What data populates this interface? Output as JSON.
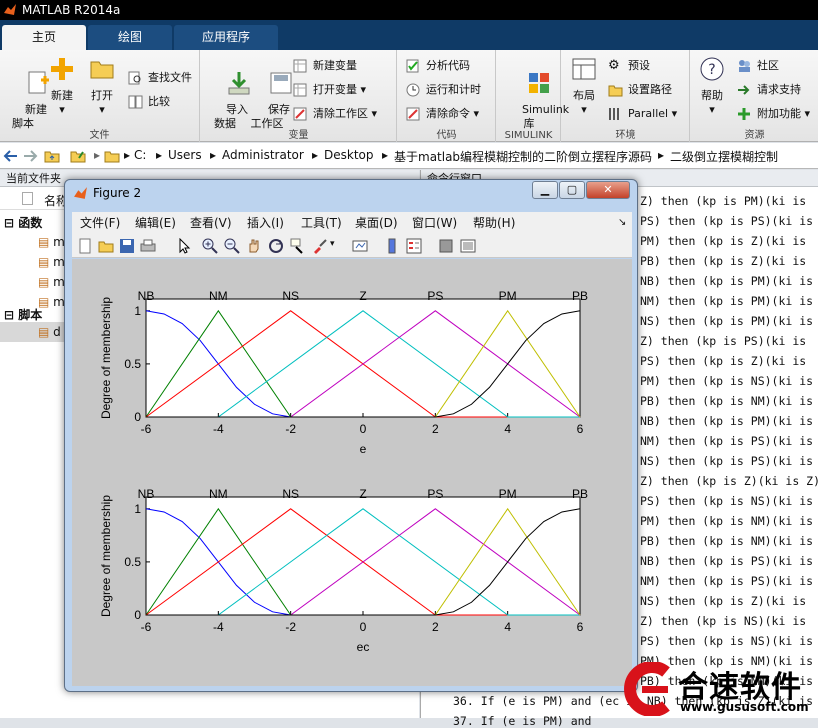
{
  "app": {
    "title": "MATLAB R2014a"
  },
  "tabs": [
    "主页",
    "绘图",
    "应用程序"
  ],
  "ribbon": {
    "file": {
      "label": "文件",
      "new_script": "新建\n脚本",
      "new": "新建",
      "open": "打开",
      "find_files": "查找文件",
      "compare": "比较"
    },
    "variable": {
      "label": "变量",
      "import_data": "导入\n数据",
      "save_workspace": "保存\n工作区",
      "new_variable": "新建变量",
      "open_variable": "打开变量",
      "clear_workspace": "清除工作区"
    },
    "code": {
      "label": "代码",
      "analyze_code": "分析代码",
      "run_and_time": "运行和计时",
      "clear_commands": "清除命令"
    },
    "simulink": {
      "label": "SIMULINK",
      "library": "Simulink\n库"
    },
    "environment": {
      "label": "环境",
      "layout": "布局",
      "preferences": "预设",
      "set_path": "设置路径",
      "parallel": "Parallel"
    },
    "resources": {
      "label": "资源",
      "help": "帮助",
      "community": "社区",
      "request_support": "请求支持",
      "add_ons": "附加功能"
    }
  },
  "address": {
    "crumbs": [
      "C:",
      "Users",
      "Administrator",
      "Desktop",
      "基于matlab编程模糊控制的二阶倒立摆程序源码",
      "二级倒立摆模糊控制"
    ]
  },
  "current_folder": {
    "title": "当前文件夹",
    "name_header": "名称",
    "groups": [
      {
        "label": "函数",
        "items": [
          "m",
          "m",
          "m",
          "m"
        ]
      },
      {
        "label": "脚本",
        "items": [
          "d"
        ]
      }
    ]
  },
  "command_window": {
    "title": "命令行窗口",
    "lines": [
      "Z) then (kp is PM)(ki is",
      "PS) then (kp is PS)(ki is",
      "PM) then (kp is Z)(ki is",
      "PB) then (kp is Z)(ki is",
      "NB) then (kp is PM)(ki is",
      "NM) then (kp is PM)(ki is",
      "NS) then (kp is PM)(ki is",
      "Z) then (kp is PS)(ki is",
      "PS) then (kp is Z)(ki is",
      "PM) then (kp is NS)(ki is",
      "PB) then (kp is NM)(ki is",
      "NB) then (kp is PM)(ki is",
      "NM) then (kp is PS)(ki is",
      "NS) then (kp is PS)(ki is",
      "Z) then (kp is Z)(ki is Z)",
      "PS) then (kp is NS)(ki is",
      "PM) then (kp is NM)(ki is",
      "PB) then (kp is NM)(ki is",
      "NB) then (kp is PS)(ki is",
      "NM) then (kp is PS)(ki is",
      "NS) then (kp is Z)(ki is",
      "Z) then (kp is NS)(ki is",
      "PS) then (kp is NS)(ki is",
      "PM) then (kp is NM)(ki is",
      "PB) then (kp is NM)(ki is",
      "36. If (e is PM) and (ec is NB) then (kp is Z)(ki is"
    ],
    "last_line_prefix": "37. If (e is PM) and"
  },
  "figure": {
    "title": "Figure 2",
    "menu": [
      "文件(F)",
      "编辑(E)",
      "查看(V)",
      "插入(I)",
      "工具(T)",
      "桌面(D)",
      "窗口(W)",
      "帮助(H)"
    ]
  },
  "chart_data": [
    {
      "type": "line",
      "xlabel": "e",
      "ylabel": "Degree of membership",
      "xlim": [
        -6,
        6
      ],
      "ylim": [
        0,
        1
      ],
      "xticks": [
        "-6",
        "-4",
        "-2",
        "0",
        "2",
        "4",
        "6"
      ],
      "yticks": [
        "0",
        "0.5",
        "1"
      ],
      "series": [
        {
          "name": "NB",
          "color": "#0000ff",
          "x": [
            -6,
            -5.5,
            -5,
            -4.5,
            -4,
            -3.5,
            -3,
            -2.5,
            -2,
            6
          ],
          "y": [
            1,
            0.97,
            0.88,
            0.72,
            0.5,
            0.28,
            0.12,
            0.03,
            0,
            0
          ]
        },
        {
          "name": "NM",
          "color": "#008000",
          "x": [
            -6,
            -4,
            -2,
            6
          ],
          "y": [
            0,
            1,
            0,
            0
          ]
        },
        {
          "name": "NS",
          "color": "#ff0000",
          "x": [
            -6,
            -2,
            2,
            6
          ],
          "y": [
            0,
            1,
            0,
            0
          ]
        },
        {
          "name": "Z",
          "color": "#00bfbf",
          "x": [
            -6,
            -4,
            0,
            4,
            6
          ],
          "y": [
            0,
            0,
            1,
            0,
            0
          ]
        },
        {
          "name": "PS",
          "color": "#bf00bf",
          "x": [
            -6,
            -2,
            2,
            6
          ],
          "y": [
            0,
            0,
            1,
            0
          ]
        },
        {
          "name": "PM",
          "color": "#bfbf00",
          "x": [
            -6,
            2,
            4,
            6
          ],
          "y": [
            0,
            0,
            1,
            0
          ]
        },
        {
          "name": "PB",
          "color": "#000000",
          "x": [
            -6,
            2,
            2.5,
            3,
            3.5,
            4,
            4.5,
            5,
            5.5,
            6
          ],
          "y": [
            0,
            0,
            0.03,
            0.12,
            0.28,
            0.5,
            0.72,
            0.88,
            0.97,
            1
          ]
        }
      ]
    },
    {
      "type": "line",
      "xlabel": "ec",
      "ylabel": "Degree of membership",
      "xlim": [
        -6,
        6
      ],
      "ylim": [
        0,
        1
      ],
      "xticks": [
        "-6",
        "-4",
        "-2",
        "0",
        "2",
        "4",
        "6"
      ],
      "yticks": [
        "0",
        "0.5",
        "1"
      ],
      "series": [
        {
          "name": "NB",
          "color": "#0000ff",
          "x": [
            -6,
            -5.5,
            -5,
            -4.5,
            -4,
            -3.5,
            -3,
            -2.5,
            -2,
            6
          ],
          "y": [
            1,
            0.97,
            0.88,
            0.72,
            0.5,
            0.28,
            0.12,
            0.03,
            0,
            0
          ]
        },
        {
          "name": "NM",
          "color": "#008000",
          "x": [
            -6,
            -4,
            -2,
            6
          ],
          "y": [
            0,
            1,
            0,
            0
          ]
        },
        {
          "name": "NS",
          "color": "#ff0000",
          "x": [
            -6,
            -2,
            2,
            6
          ],
          "y": [
            0,
            1,
            0,
            0
          ]
        },
        {
          "name": "Z",
          "color": "#00bfbf",
          "x": [
            -6,
            -4,
            0,
            4,
            6
          ],
          "y": [
            0,
            0,
            1,
            0,
            0
          ]
        },
        {
          "name": "PS",
          "color": "#bf00bf",
          "x": [
            -6,
            -2,
            2,
            6
          ],
          "y": [
            0,
            0,
            1,
            0
          ]
        },
        {
          "name": "PM",
          "color": "#bfbf00",
          "x": [
            -6,
            2,
            4,
            6
          ],
          "y": [
            0,
            0,
            1,
            0
          ]
        },
        {
          "name": "PB",
          "color": "#000000",
          "x": [
            -6,
            2,
            2.5,
            3,
            3.5,
            4,
            4.5,
            5,
            5.5,
            6
          ],
          "y": [
            0,
            0,
            0.03,
            0.12,
            0.28,
            0.5,
            0.72,
            0.88,
            0.97,
            1
          ]
        }
      ]
    }
  ],
  "watermark": {
    "brand": "合速软件",
    "url": "www.gususoft.com"
  }
}
